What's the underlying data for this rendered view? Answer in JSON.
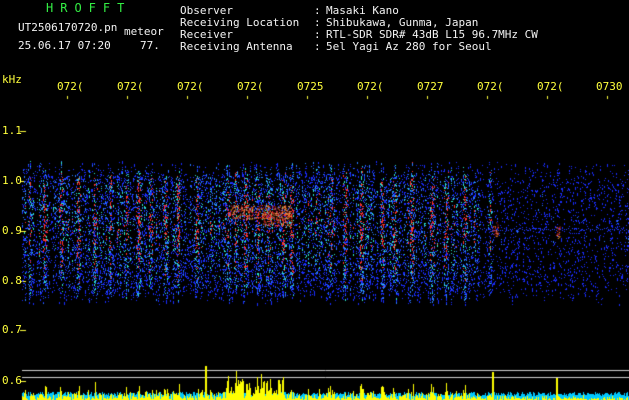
{
  "header": {
    "app_name": "HROFFT",
    "filename": "UT2506170720.pn",
    "event_type": "meteor",
    "datetime": "25.06.17 07:20",
    "count": "77."
  },
  "station_info": [
    {
      "label": "Observer",
      "value": "Masaki Kano"
    },
    {
      "label": "Receiving Location",
      "value": "Shibukawa, Gunma, Japan"
    },
    {
      "label": "Receiver",
      "value": "RTL-SDR SDR# 43dB L15 96.7MHz CW"
    },
    {
      "label": "Receiving Antenna",
      "value": "5el Yagi Az 280 for Seoul"
    }
  ],
  "spectrogram": {
    "y_unit": "kHz",
    "y_ticks": [
      "1.1",
      "1.0",
      "0.9",
      "0.8",
      "0.7",
      "0.6"
    ],
    "time_ticks": [
      "072(",
      "072(",
      "072(",
      "072(",
      "0725",
      "072(",
      "0727",
      "072(",
      "072(",
      "0730"
    ],
    "colors": {
      "background": "#000000",
      "label_yellow": "#ffff3c",
      "title_green": "#33ee44",
      "signal_low": "#1a2cff",
      "signal_mid": "#2ee8c8",
      "signal_high": "#ff3030",
      "level_fill": "#ffff00",
      "level_noise": "#00c8ff"
    }
  }
}
